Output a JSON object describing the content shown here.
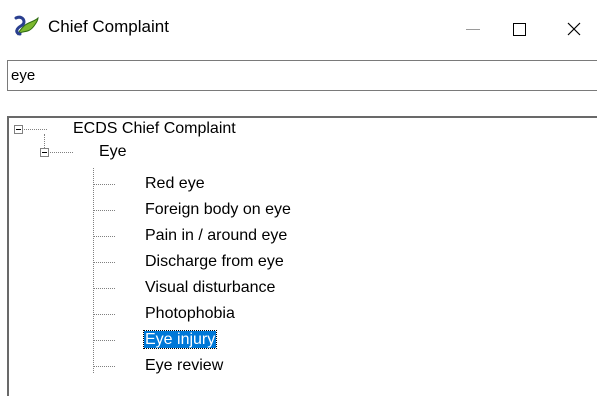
{
  "window": {
    "title": "Chief Complaint",
    "minimize_label": "—",
    "close_label": "✕"
  },
  "search": {
    "value": "eye"
  },
  "tree": {
    "root": {
      "label": "ECDS Chief Complaint",
      "expanded": true,
      "children": [
        {
          "label": "Eye",
          "expanded": true,
          "items": [
            "Red eye",
            "Foreign body on eye",
            "Pain in / around eye",
            "Discharge from eye",
            "Visual disturbance",
            "Photophobia",
            "Eye injury",
            "Eye review"
          ],
          "selected_index": 6
        }
      ]
    }
  },
  "colors": {
    "selection": "#0078d7",
    "tree_lines": "#808080"
  }
}
